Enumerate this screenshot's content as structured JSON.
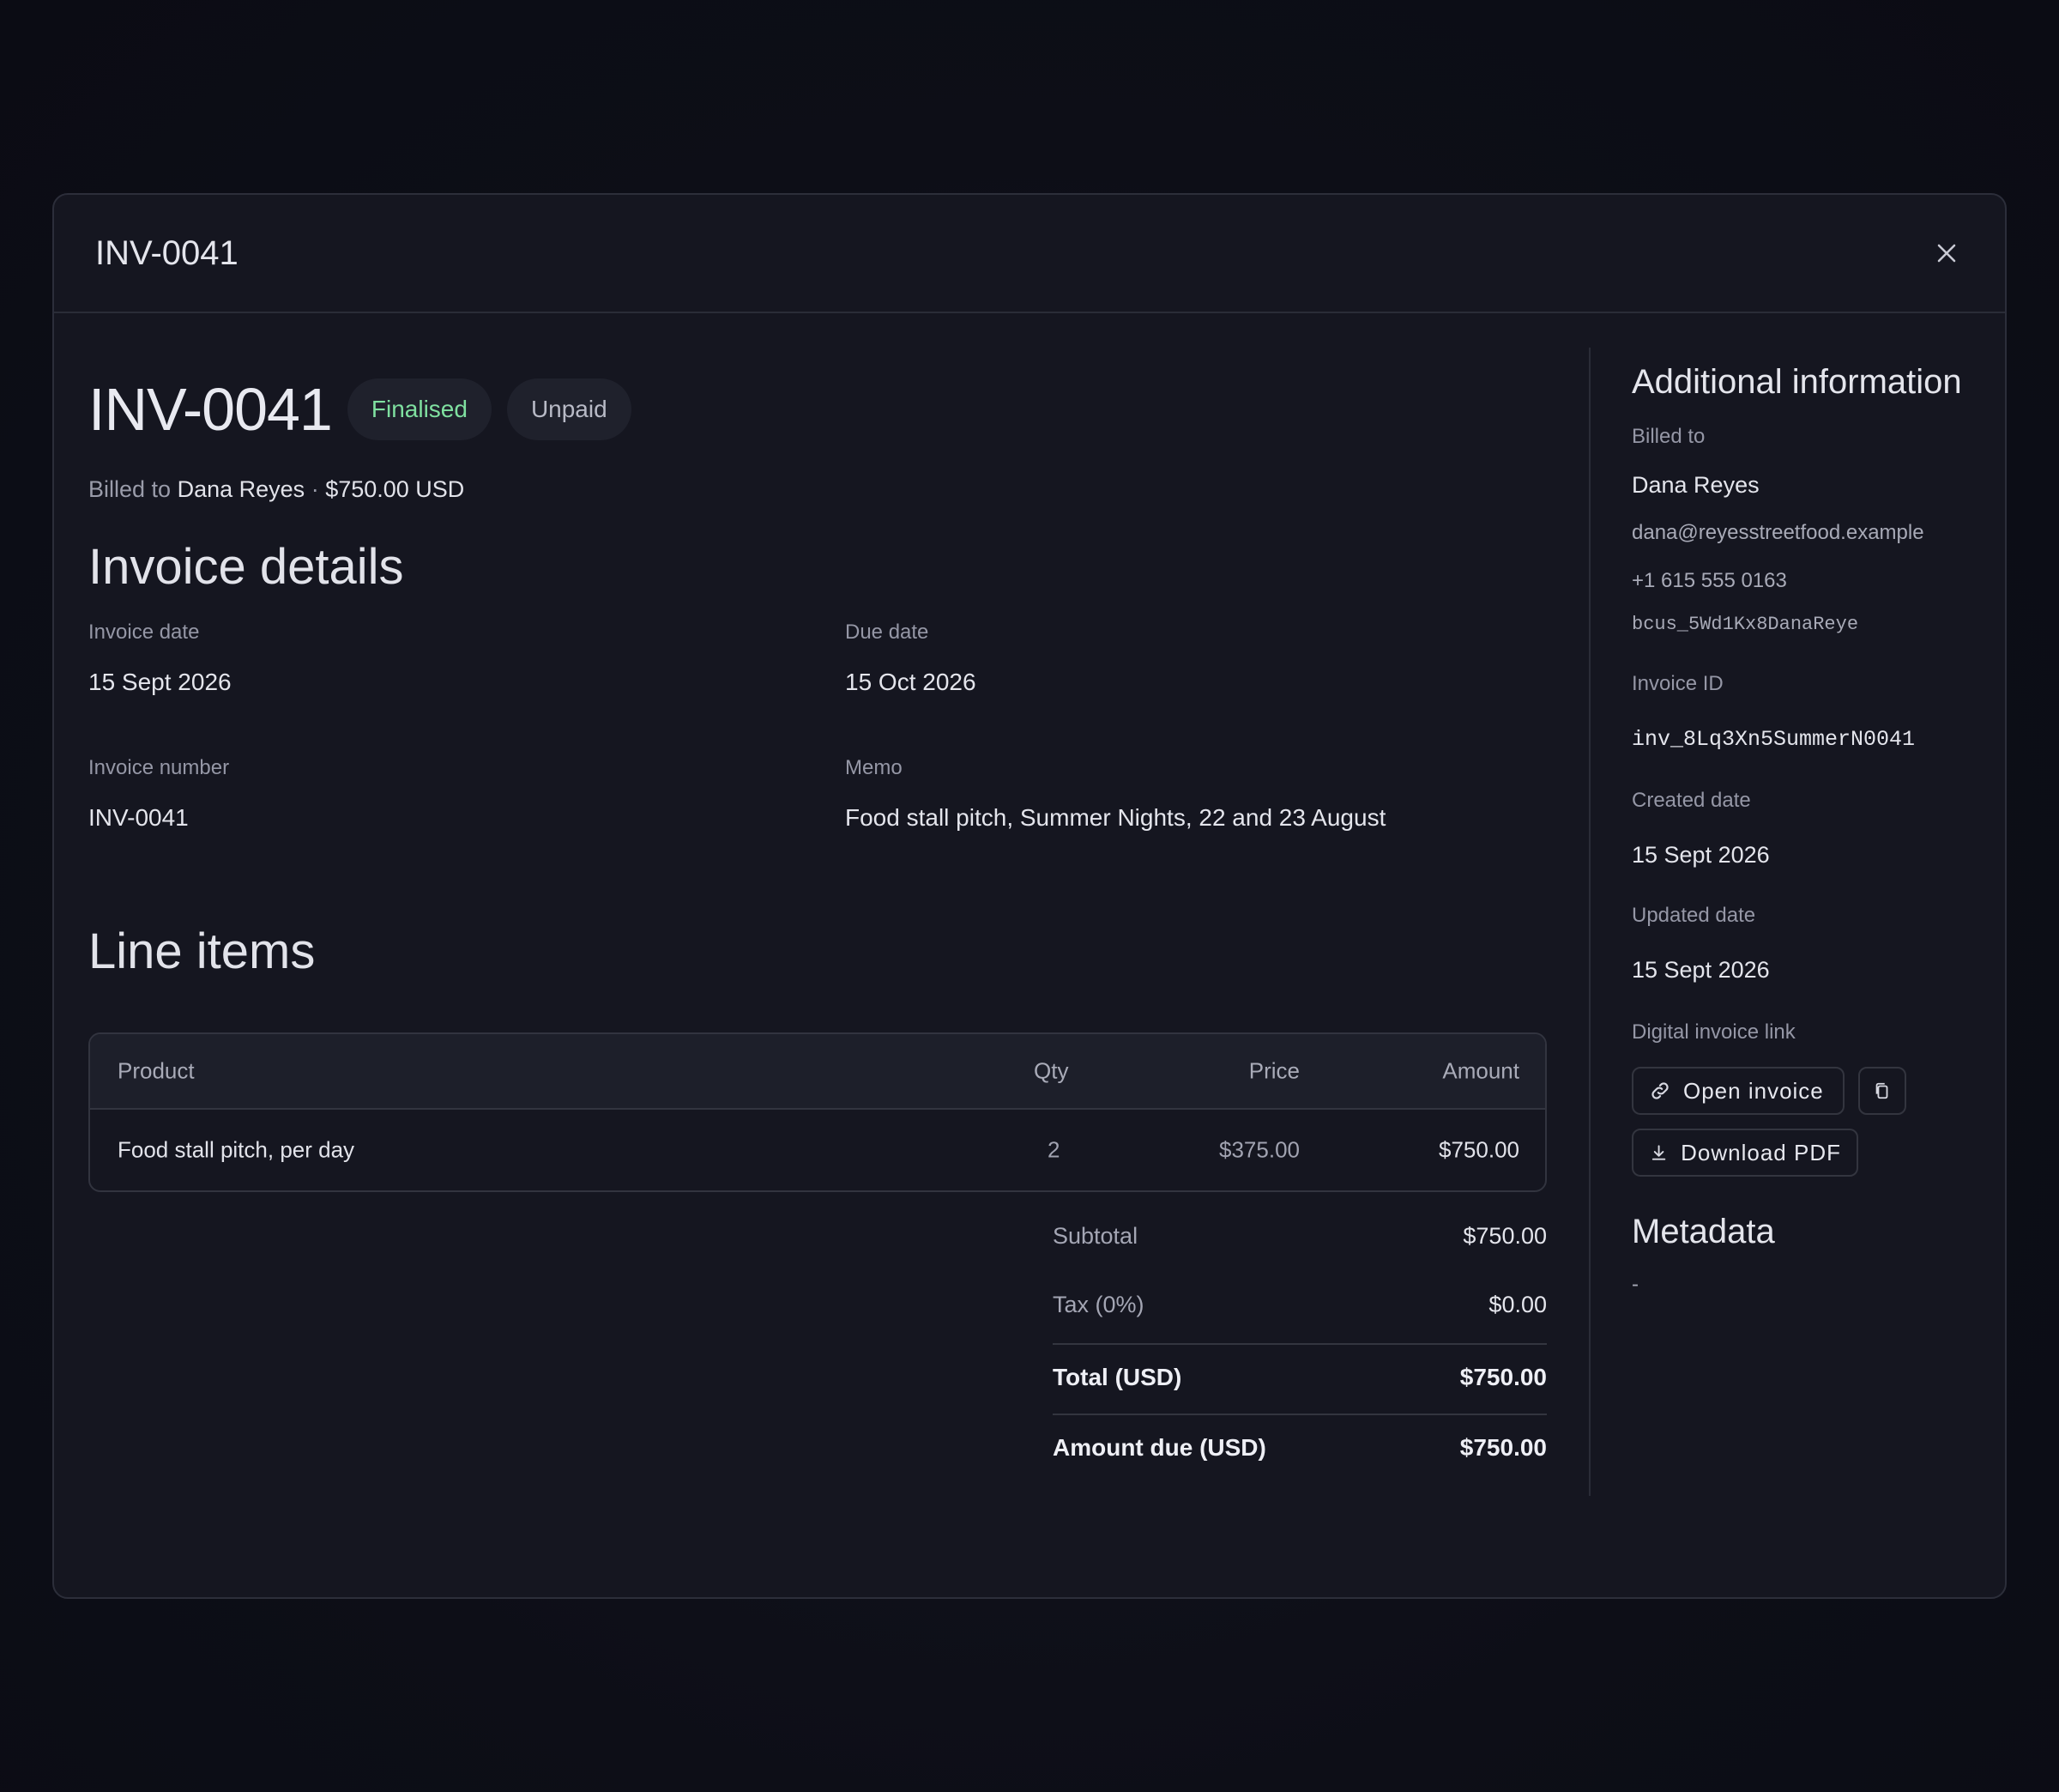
{
  "modal": {
    "title": "INV-0041"
  },
  "hero": {
    "invoice_number": "INV-0041",
    "status_badge": "Finalised",
    "payment_badge": "Unpaid",
    "billed_prefix": "Billed to",
    "billed_name": "Dana Reyes",
    "separator": "·",
    "billed_amount": "$750.00 USD"
  },
  "details": {
    "heading": "Invoice details",
    "invoice_date_label": "Invoice date",
    "invoice_date": "15 Sept 2026",
    "due_date_label": "Due date",
    "due_date": "15 Oct 2026",
    "invoice_number_label": "Invoice number",
    "invoice_number": "INV-0041",
    "memo_label": "Memo",
    "memo": "Food stall pitch, Summer Nights, 22 and 23 August"
  },
  "line_items": {
    "heading": "Line items",
    "columns": {
      "product": "Product",
      "qty": "Qty",
      "price": "Price",
      "amount": "Amount"
    },
    "rows": [
      {
        "product": "Food stall pitch, per day",
        "qty": "2",
        "price": "$375.00",
        "amount": "$750.00"
      }
    ]
  },
  "totals": {
    "subtotal_label": "Subtotal",
    "subtotal": "$750.00",
    "tax_label": "Tax (0%)",
    "tax": "$0.00",
    "total_label": "Total (USD)",
    "total": "$750.00",
    "amount_due_label": "Amount due (USD)",
    "amount_due": "$750.00"
  },
  "sidebar": {
    "heading": "Additional information",
    "billed_to_label": "Billed to",
    "customer_name": "Dana Reyes",
    "customer_email": "dana@reyesstreetfood.example",
    "customer_phone": "+1 615 555 0163",
    "customer_id": "bcus_5Wd1Kx8DanaReye",
    "invoice_id_label": "Invoice ID",
    "invoice_id": "inv_8Lq3Xn5SummerN0041",
    "created_label": "Created date",
    "created": "15 Sept 2026",
    "updated_label": "Updated date",
    "updated": "15 Sept 2026",
    "link_label": "Digital invoice link",
    "open_invoice": "Open invoice",
    "download_pdf": "Download PDF",
    "metadata_heading": "Metadata",
    "metadata_value": "-"
  }
}
